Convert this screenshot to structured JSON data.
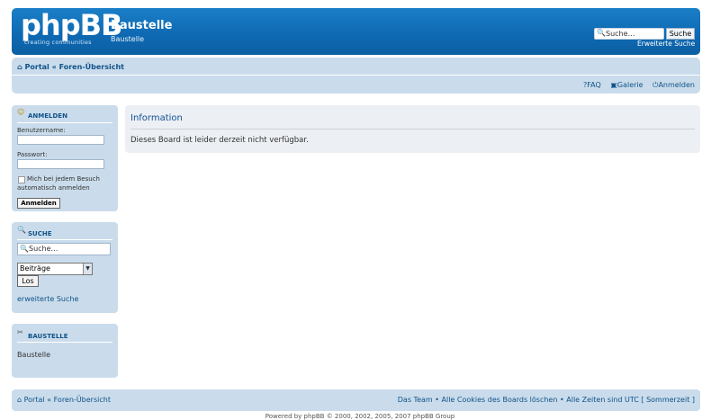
{
  "header": {
    "logo": "phpBB",
    "logo_sub": "creating communities",
    "title": "Baustelle",
    "description": "Baustelle",
    "search_placeholder": "Suche…",
    "search_button": "Suche",
    "advanced_search": "Erweiterte Suche"
  },
  "nav": {
    "breadcrumb_portal": "Portal",
    "breadcrumb_sep": "«",
    "breadcrumb_index": "Foren-Übersicht",
    "faq": "FAQ",
    "gallery": "Galerie",
    "login": "Anmelden"
  },
  "login_panel": {
    "title": "ANMELDEN",
    "username_label": "Benutzername:",
    "password_label": "Passwort:",
    "remember_line1": "Mich bei jedem Besuch",
    "remember_line2": "automatisch anmelden",
    "submit": "Anmelden"
  },
  "search_panel": {
    "title": "SUCHE",
    "placeholder": "Suche…",
    "select_value": "Beiträge",
    "go_button": "Los",
    "advanced": "erweiterte Suche"
  },
  "site_panel": {
    "title": "BAUSTELLE",
    "text": "Baustelle"
  },
  "content": {
    "heading": "Information",
    "message": "Dieses Board ist leider derzeit nicht verfügbar."
  },
  "footer": {
    "portal": "Portal",
    "sep": "«",
    "index": "Foren-Übersicht",
    "team": "Das Team",
    "bullet": "•",
    "delete_cookies": "Alle Cookies des Boards löschen",
    "timezone": "Alle Zeiten sind UTC [ Sommerzeit ]",
    "powered": "Powered by phpBB © 2000, 2002, 2005, 2007 phpBB Group"
  },
  "colors": {
    "header_blue": "#0f6ab3",
    "panel_blue": "#cadceb",
    "link_blue": "#105289"
  }
}
